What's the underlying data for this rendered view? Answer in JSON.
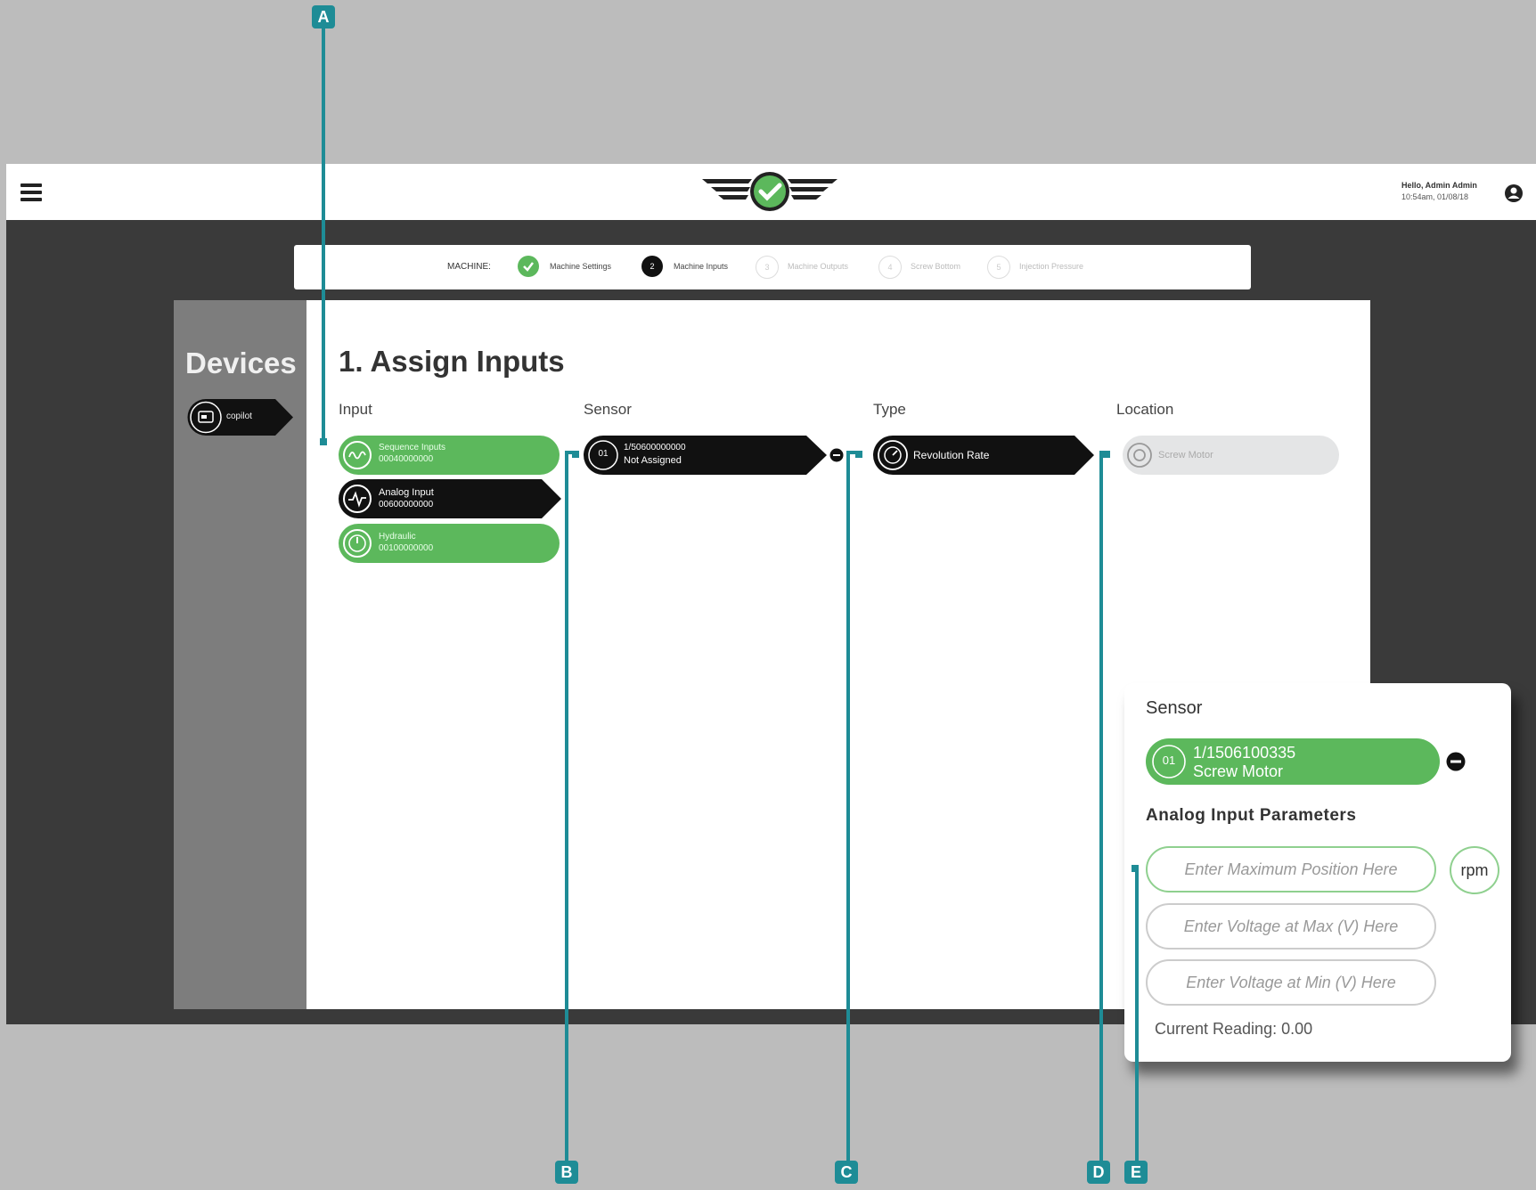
{
  "header": {
    "greeting": "Hello, Admin Admin",
    "datetime": "10:54am, 01/08/18"
  },
  "stepper": {
    "label": "MACHINE:",
    "steps": [
      {
        "number": "",
        "label": "Machine Settings",
        "state": "done"
      },
      {
        "number": "2",
        "label": "Machine Inputs",
        "state": "active"
      },
      {
        "number": "3",
        "label": "Machine Outputs",
        "state": "pending"
      },
      {
        "number": "4",
        "label": "Screw Bottom",
        "state": "pending"
      },
      {
        "number": "5",
        "label": "Injection Pressure",
        "state": "pending"
      }
    ]
  },
  "devices": {
    "title": "Devices",
    "item_label": "copilot"
  },
  "main": {
    "title": "1. Assign Inputs",
    "columns": {
      "input": "Input",
      "sensor": "Sensor",
      "type": "Type",
      "location": "Location"
    },
    "inputs": [
      {
        "name": "Sequence Inputs",
        "id": "00040000000",
        "color": "#5cb85c"
      },
      {
        "name": "Analog Input",
        "id": "00600000000",
        "color": "#111111"
      },
      {
        "name": "Hydraulic",
        "id": "00100000000",
        "color": "#5cb85c"
      }
    ],
    "sensor": {
      "channel": "01",
      "serial": "1/50600000000",
      "status": "Not Assigned"
    },
    "type": {
      "label": "Revolution Rate"
    },
    "location": {
      "label": "Screw Motor"
    }
  },
  "popup": {
    "sensor_header": "Sensor",
    "sensor_channel": "01",
    "sensor_serial": "1/1506100335",
    "sensor_location": "Screw Motor",
    "params_header": "Analog Input Parameters",
    "max_position_placeholder": "Enter Maximum Position Here",
    "unit": "rpm",
    "voltage_max_placeholder": "Enter Voltage at Max (V) Here",
    "voltage_min_placeholder": "Enter Voltage at Min (V) Here",
    "current_reading": "Current Reading: 0.00"
  },
  "annotations": [
    "A",
    "B",
    "C",
    "D",
    "E"
  ],
  "colors": {
    "accent_green": "#5cb85c",
    "annotation_teal": "#1e8c96",
    "dark": "#111111"
  }
}
